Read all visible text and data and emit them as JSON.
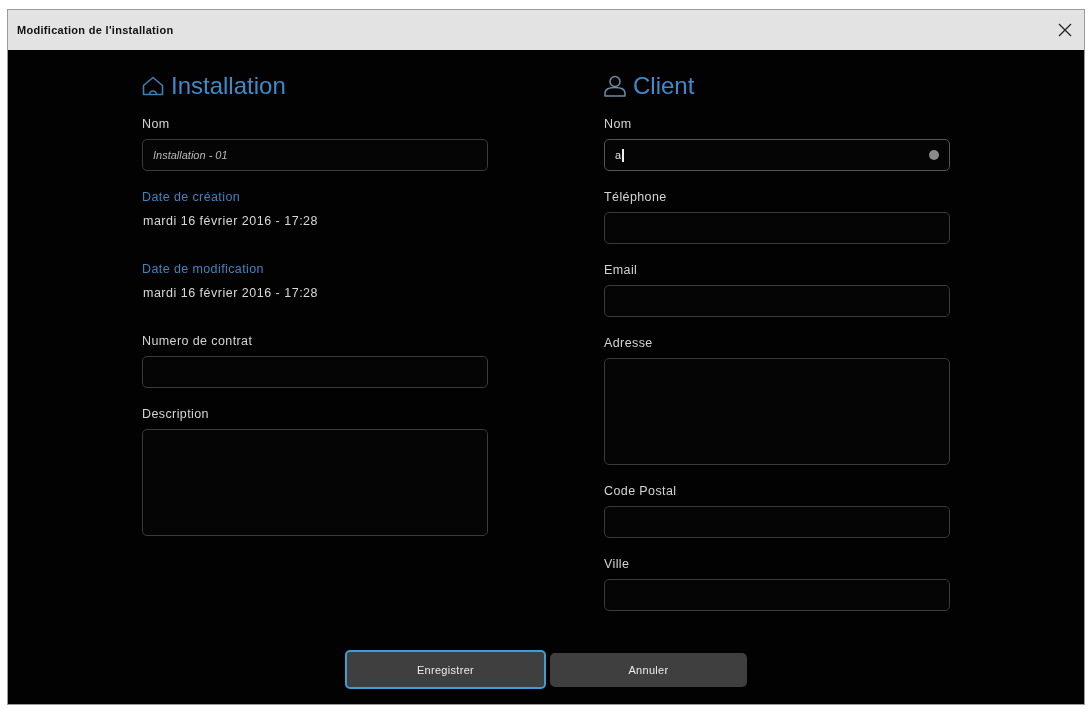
{
  "window": {
    "title": "Modification de l'installation"
  },
  "sections": [
    {
      "heading": "Installation",
      "fields": [
        {
          "kind": "input",
          "label": "Nom",
          "placeholder": "Installation - 01",
          "focused": false
        },
        {
          "kind": "info",
          "label": "Date de création",
          "value": "mardi 16 février 2016 - 17:28"
        },
        {
          "kind": "info",
          "label": "Date de modification",
          "value": "mardi 16 février 2016 - 17:28"
        },
        {
          "kind": "input",
          "label": "Numero de contrat",
          "focused": false
        },
        {
          "kind": "textarea",
          "label": "Description",
          "focused": false
        }
      ]
    },
    {
      "heading": "Client",
      "fields": [
        {
          "kind": "input",
          "label": "Nom",
          "value": "a",
          "focused": true
        },
        {
          "kind": "input",
          "label": "Téléphone",
          "focused": false
        },
        {
          "kind": "input",
          "label": "Email",
          "focused": false
        },
        {
          "kind": "textarea",
          "label": "Adresse",
          "focused": false
        },
        {
          "kind": "input",
          "label": "Code Postal",
          "focused": false
        },
        {
          "kind": "input",
          "label": "Ville",
          "focused": false
        }
      ]
    }
  ],
  "buttons": [
    {
      "label": "Enregistrer",
      "focused": true
    },
    {
      "label": "Annuler",
      "focused": false
    }
  ]
}
